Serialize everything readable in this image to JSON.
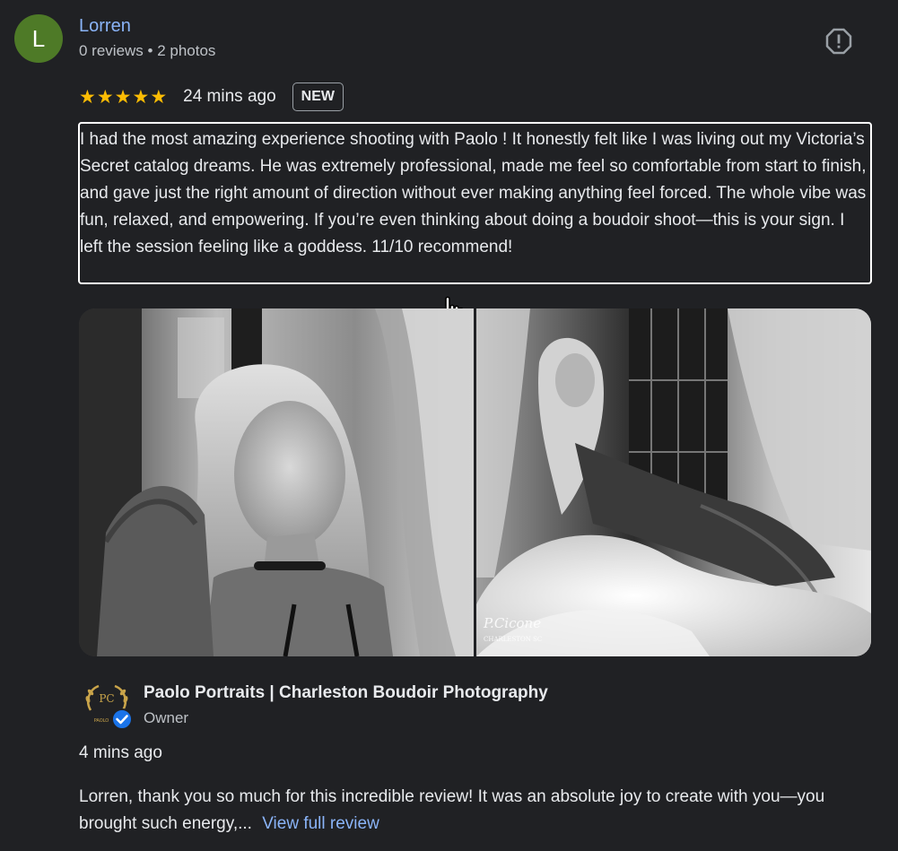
{
  "reviewer": {
    "initial": "L",
    "name": "Lorren",
    "meta": "0 reviews • 2 photos",
    "avatar_color": "#4e7a27"
  },
  "rating": {
    "stars": 5,
    "star_glyph": "★",
    "time": "24 mins ago",
    "badge": "NEW"
  },
  "review": {
    "text": "I had the most amazing experience shooting with Paolo ! It honestly felt like I was living out my Victoria’s Secret catalog dreams. He was extremely professional, made me feel so comfortable from start to finish, and gave just the right amount of direction without ever making anything feel forced. The whole vibe was fun, relaxed, and empowering. If you’re even thinking about doing a boudoir shoot—this is your sign. I left the session feeling like a goddess. 11/10 recommend!"
  },
  "photos": {
    "watermark_signature": "P.Cicone",
    "watermark_city": "CHARLESTON SC"
  },
  "owner_response": {
    "logo_text": "PC",
    "logo_subtext": "PAOLO",
    "name": "Paolo Portraits | Charleston Boudoir Photography",
    "role": "Owner",
    "time": "4 mins ago",
    "text": "Lorren, thank you so much for this incredible review! It was an absolute joy to create with you—you brought such energy,...",
    "view_full_label": "View full review"
  },
  "icons": {
    "report": "report-icon",
    "verified": "verified-check-icon",
    "cursor": "hand-pointer-icon"
  },
  "colors": {
    "background": "#202124",
    "link": "#8ab4f8",
    "star": "#fbbc04",
    "verified": "#1a73e8"
  }
}
